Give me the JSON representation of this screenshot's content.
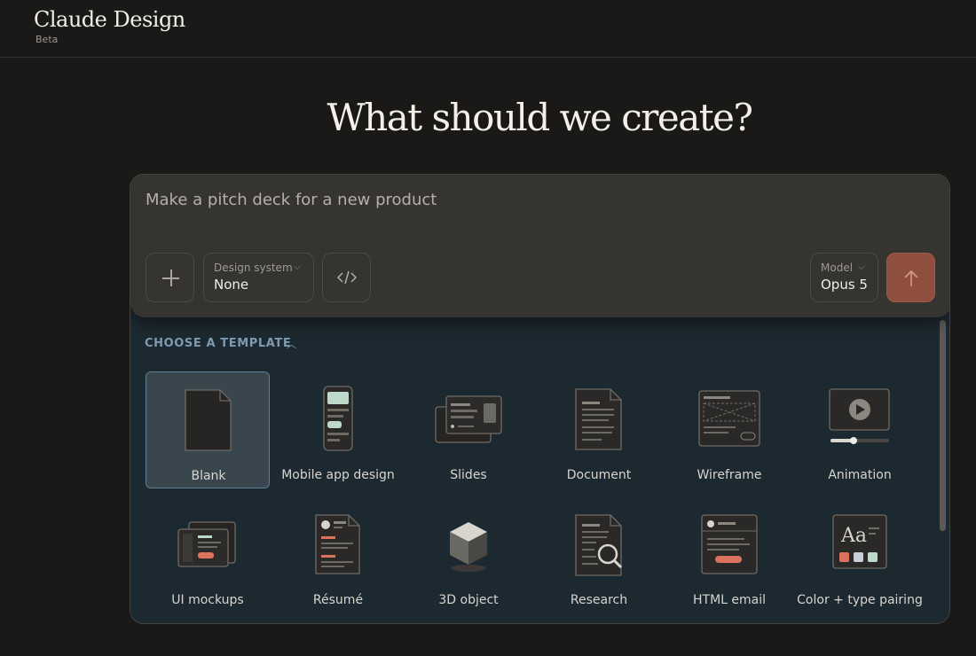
{
  "brand": {
    "title": "Claude Design",
    "badge": "Beta"
  },
  "headline": "What should we create?",
  "prompt": {
    "placeholder": "Make a pitch deck for a new product"
  },
  "controls": {
    "design_system": {
      "label": "Design system",
      "value": "None"
    },
    "model": {
      "label": "Model",
      "value": "Opus 5"
    }
  },
  "templates": {
    "header": "CHOOSE A TEMPLATE",
    "selected": "Blank",
    "items": [
      {
        "label": "Blank",
        "icon": "blank-page-icon"
      },
      {
        "label": "Mobile app design",
        "icon": "mobile-phone-icon"
      },
      {
        "label": "Slides",
        "icon": "slides-icon"
      },
      {
        "label": "Document",
        "icon": "document-icon"
      },
      {
        "label": "Wireframe",
        "icon": "wireframe-icon"
      },
      {
        "label": "Animation",
        "icon": "animation-player-icon"
      },
      {
        "label": "UI mockups",
        "icon": "ui-mockups-icon"
      },
      {
        "label": "Résumé",
        "icon": "resume-icon"
      },
      {
        "label": "3D object",
        "icon": "cube-icon"
      },
      {
        "label": "Research",
        "icon": "research-magnifier-icon"
      },
      {
        "label": "HTML email",
        "icon": "html-email-icon"
      },
      {
        "label": "Color + type pairing",
        "icon": "color-type-pairing-icon"
      }
    ]
  },
  "colors": {
    "background": "#1a1918",
    "accent_send": "#8e4f3e",
    "template_panel": "#1d2930",
    "template_header": "#7f9ab0",
    "selection_border": "#5e7c92"
  }
}
